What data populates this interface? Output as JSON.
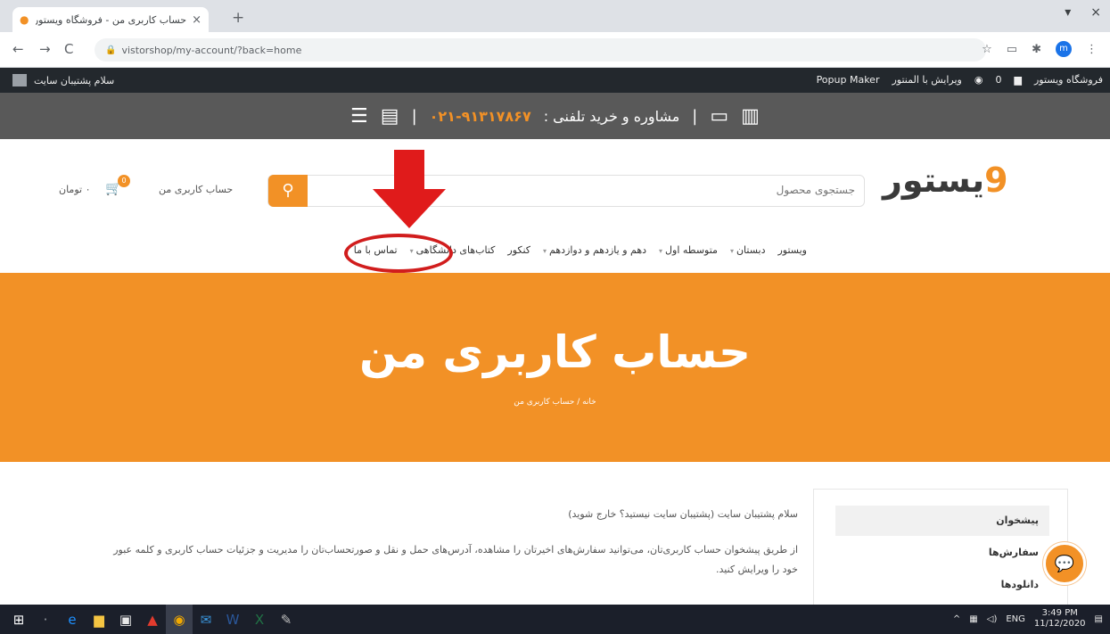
{
  "browser": {
    "tab_title": "حساب کاربری من - فروشگاه ویستور",
    "new_tab": "+",
    "window_controls": [
      "▾",
      "×"
    ],
    "url": "vistorshop/my-account/?back=home",
    "nav": [
      "←",
      "→",
      "C"
    ]
  },
  "adminbar": {
    "right_items": [
      "فروشگاه ویستور",
      "0",
      "ویرایش با المنتور",
      "Popup Maker"
    ],
    "greeting": "سلام پشتیبان سایت"
  },
  "banner": {
    "text": "مشاوره و خرید تلفنی :",
    "phone": "۰۲۱-۹۱۳۱۷۸۶۷"
  },
  "header": {
    "logo_text": "یستور",
    "logo_accent": "9",
    "search_placeholder": "جستجوی محصول",
    "account_link": "حساب کاربری من",
    "cart_count": "0",
    "cart_total": "۰ تومان"
  },
  "nav": {
    "items": [
      "ویستور",
      "دبستان",
      "متوسطه اول",
      "دهم و یازدهم و دوازدهم",
      "کنکور",
      "کتاب‌های دانشگاهی",
      "تماس با ما"
    ]
  },
  "hero": {
    "title": "حساب کاربری من",
    "breadcrumb": "خانه / حساب کاربری من"
  },
  "account": {
    "menu": [
      "پیشخوان",
      "سفارش‌ها",
      "دانلودها"
    ],
    "welcome": "سلام پشتیبان سایت (پشتیبان سایت نیستید؟ خارج شوید)",
    "body": "از طریق پیشخوان حساب کاربری‌تان، می‌توانید سفارش‌های اخیرتان را مشاهده، آدرس‌های حمل و نقل و صورتحساب‌تان را مدیریت و جزئیات حساب کاربری و کلمه عبور خود را ویرایش کنید."
  },
  "taskbar": {
    "time": "3:49 PM",
    "date": "11/12/2020",
    "lang": "ENG"
  },
  "colors": {
    "accent": "#f29126",
    "annotation": "#d11d1d",
    "banner": "#595959",
    "adminbar": "#23282d"
  }
}
